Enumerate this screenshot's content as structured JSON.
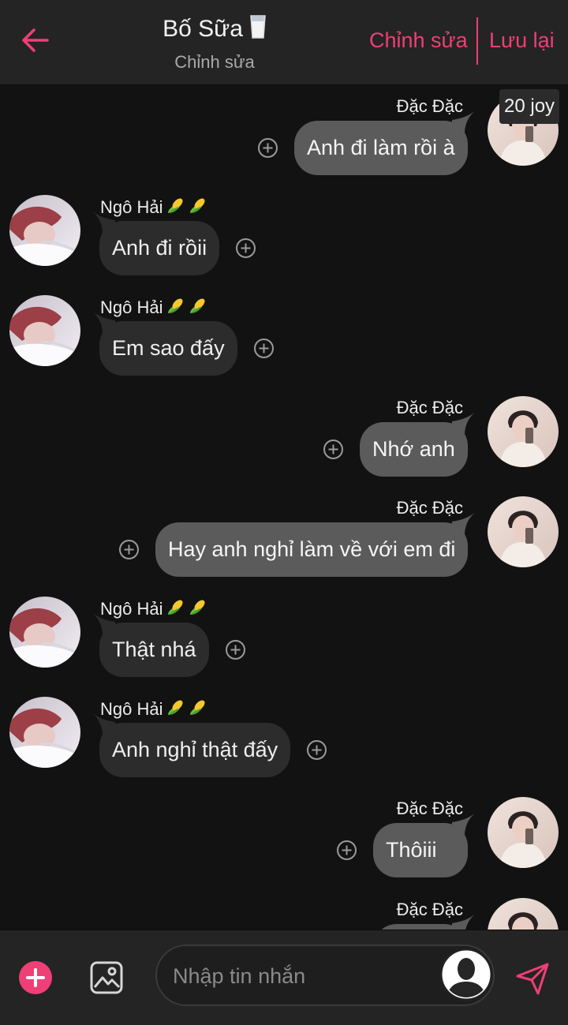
{
  "header": {
    "title": "Bố Sữa",
    "subtitle": "Chỉnh sửa",
    "edit_label": "Chỉnh sửa",
    "save_label": "Lưu lại"
  },
  "colors": {
    "accent": "#ef3f77",
    "incoming_bubble": "#2c2c2c",
    "outgoing_bubble": "#5b5b5b"
  },
  "badge": "20 joy",
  "messages": [
    {
      "side": "out",
      "name": "Đặc Đặc",
      "text": "Anh đi làm rồi à"
    },
    {
      "side": "in",
      "name": "Ngô Hải",
      "text": "Anh đi rồii"
    },
    {
      "side": "in",
      "name": "Ngô Hải",
      "text": "Em sao đấy"
    },
    {
      "side": "out",
      "name": "Đặc Đặc",
      "text": "Nhớ anh"
    },
    {
      "side": "out",
      "name": "Đặc Đặc",
      "text": "Hay anh nghỉ làm về với em đi"
    },
    {
      "side": "in",
      "name": "Ngô Hải",
      "text": "Thật nhá"
    },
    {
      "side": "in",
      "name": "Ngô Hải",
      "text": "Anh nghỉ thật đấy"
    },
    {
      "side": "out",
      "name": "Đặc Đặc",
      "text": "Thôiii"
    },
    {
      "side": "out",
      "name": "Đặc Đặc",
      "text": ""
    }
  ],
  "composer": {
    "placeholder": "Nhập tin nhắn"
  }
}
